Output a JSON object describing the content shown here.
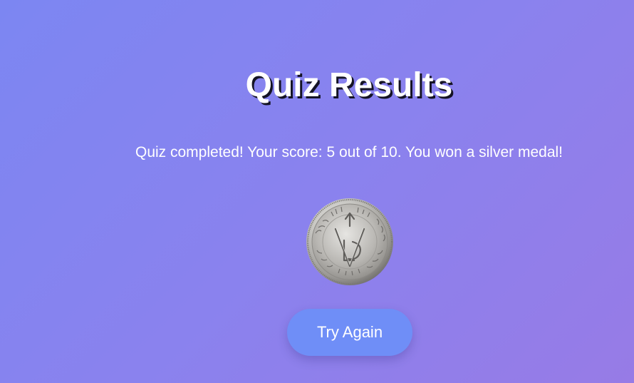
{
  "results": {
    "title": "Quiz Results",
    "message": "Quiz completed! Your score: 5 out of 10. You won a silver medal!",
    "score": 5,
    "total": 10,
    "medal": "silver",
    "medal_icon": "silver-coin-icon",
    "try_again_label": "Try Again"
  },
  "colors": {
    "background_start": "#7c86f2",
    "background_end": "#977be6",
    "button": "#6f8ef7",
    "text": "#ffffff"
  }
}
